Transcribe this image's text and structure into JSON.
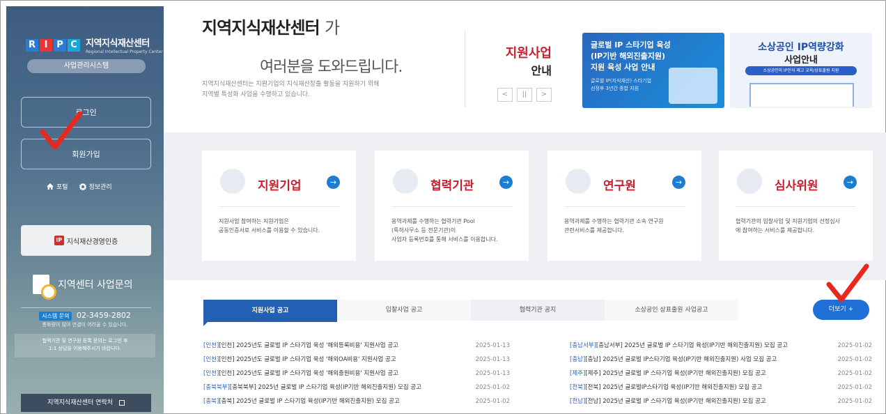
{
  "sidebar": {
    "logo_letters": [
      "R",
      "I",
      "P",
      "C"
    ],
    "logo_title": "지역지식재산센터",
    "logo_subtitle": "Regional Intellectual Property Center",
    "system_label": "사업관리시스템",
    "login_label": "로그인",
    "signup_label": "회원가입",
    "quick_links": [
      {
        "icon": "home-icon",
        "label": "포털"
      },
      {
        "icon": "gear-icon",
        "label": "정보관리"
      }
    ],
    "cert_mark": "IP",
    "cert_label": "지식재산경영인증",
    "inquiry_title": "지역센터 사업문의",
    "hotline_badge": "시스템 문의",
    "hotline_number": "02-3459-2802",
    "hotline_note": "통화량이 많아 연결이 어려울 수 있습니다.",
    "notice_line1": "협력기관 및 연구원 등록 문의는 로그인 후",
    "notice_line2": "1:1 상담을 이용해주시기 바랍니다.",
    "contact_label": "지역지식재산센터 연락처"
  },
  "hero": {
    "title_bold": "지역지식재산센터",
    "title_light": "가",
    "title_line2": "여러분을 도와드립니다.",
    "desc_line1": "지역지식재산센터는 지원기업의 지식재산창출 활동을 지원하기 위해",
    "desc_line2": "지역별 특성화 사업을 수행하고 있습니다.",
    "support_title": "지원사업",
    "support_sub": "안내",
    "controls": [
      "<",
      "||",
      ">"
    ]
  },
  "banners": [
    {
      "line1": "글로벌 IP 스타기업 육성",
      "line2": "(IP기반 해외진출지원)",
      "line3": "지원 육성 사업 안내",
      "sub1": "글로벌 IP(지식재산) 스타기업",
      "sub2": "선정후 3년간 종합 지원"
    },
    {
      "line1": "소상공인 IP역량강화",
      "line2": "사업안내",
      "pill": "소상공인의 IP인식 제고 교육/상표출원 지원"
    }
  ],
  "cards": [
    {
      "title": "지원기업",
      "desc": [
        "지원사업 참여하는 지원기업은",
        "공동인증서로 서비스를 이용할 수 있습니다."
      ]
    },
    {
      "title": "협력기관",
      "desc": [
        "용역과제를 수행하는 협력기관 Pool",
        "(특허사무소 등 전문기관)이",
        "사업자 등록번호를 통해 서비스를 이용합니다."
      ]
    },
    {
      "title": "연구원",
      "desc": [
        "용역과제를 수행하는 협력기관 소속 연구원",
        "관련서비스를 제공합니다."
      ]
    },
    {
      "title": "심사위원",
      "desc": [
        "협력기관의 입찰사업 및 지원기업의 선정심사",
        "에 참여하는 서비스를 제공합니다."
      ]
    }
  ],
  "tabs": [
    "지원사업 공고",
    "입찰사업 공고",
    "협력기관 공지",
    "소상공인 상표출원 사업공고"
  ],
  "more_label": "더보기 +",
  "notices_left": [
    {
      "tag": "[인천]",
      "title": "[인천] 2025년도 글로벌 IP 스타기업 육성 '해외등록비용' 지원사업 공고",
      "date": "2025-01-13"
    },
    {
      "tag": "[인천]",
      "title": "[인천] 2025년도 글로벌 IP 스타기업 육성 '해외OA비용' 지원사업 공고",
      "date": "2025-01-13"
    },
    {
      "tag": "[인천]",
      "title": "[인천] 2025년도 글로벌 IP 스타기업 육성 '해외출원비용' 지원사업 공고",
      "date": "2025-01-13"
    },
    {
      "tag": "[충북북부]",
      "title": "[충북북부] 2025년 글로벌 IP 스타기업 육성(IP기반 해외진출지원) 모집 공고",
      "date": "2025-01-02"
    },
    {
      "tag": "[충북]",
      "title": "[충북] 2025년 글로벌 IP 스타기업 육성(IP기반 해외진출지원) 모집 공고",
      "date": "2025-01-02"
    }
  ],
  "notices_right": [
    {
      "tag": "[충남서부]",
      "title": "[충남서부] 2025년 글로벌 IP 스타기업 육성(IP기반 해외진출지원) 모집 공고",
      "date": "2025-01-02"
    },
    {
      "tag": "[충남]",
      "title": "[충남] 2025년 글로벌 IP스타기업 육성(IP기반 해외진출지원) 사업 모집 공고",
      "date": "2025-01-02"
    },
    {
      "tag": "[제주]",
      "title": "[제주] 2025년 글로벌 IP 스타기업 육성(IP기반 해외진출지원) 모집 공고",
      "date": "2025-01-02"
    },
    {
      "tag": "[전북]",
      "title": "[전북] 2025년 글로벌IP스타기업 육성(IP기반 해외진출지원) 모집 공고",
      "date": "2025-01-02"
    },
    {
      "tag": "[전남]",
      "title": "[전남] 2025년 글로벌 IP 스타기업 육성(IP기반 해외진출지원) 모집 공고",
      "date": "2025-01-02"
    }
  ],
  "colors": {
    "accent_red": "#c81f2d",
    "accent_blue": "#1f6fd6",
    "annotation_check": "#e8281e"
  }
}
